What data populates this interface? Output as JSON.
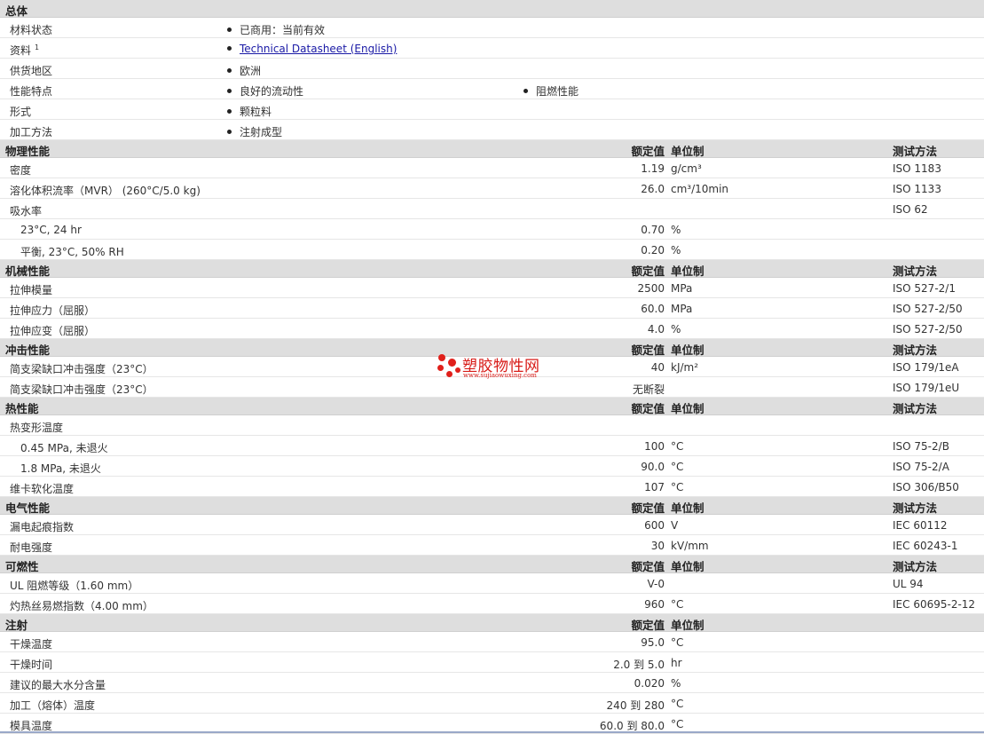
{
  "general": {
    "title": "总体",
    "rows": [
      {
        "label": "材料状态",
        "items": [
          "已商用：当前有效"
        ]
      },
      {
        "label": "资料",
        "sup": "1",
        "items": [
          "Technical Datasheet (English)"
        ],
        "link": true
      },
      {
        "label": "供货地区",
        "items": [
          "欧洲"
        ]
      },
      {
        "label": "性能特点",
        "items": [
          "良好的流动性",
          "阻燃性能"
        ]
      },
      {
        "label": "形式",
        "items": [
          "颗粒料"
        ]
      },
      {
        "label": "加工方法",
        "items": [
          "注射成型"
        ]
      }
    ]
  },
  "headers": {
    "value": "额定值",
    "unit": "单位制",
    "test": "测试方法"
  },
  "sections": [
    {
      "title": "物理性能",
      "show_test": true,
      "rows": [
        {
          "label": "密度",
          "value": "1.19",
          "unit": "g/cm³",
          "test": "ISO 1183"
        },
        {
          "label": "溶化体积流率（MVR） (260°C/5.0 kg)",
          "value": "26.0",
          "unit": "cm³/10min",
          "test": "ISO 1133"
        },
        {
          "label": "吸水率",
          "value": "",
          "unit": "",
          "test": "ISO 62"
        },
        {
          "label": "23°C, 24 hr",
          "value": "0.70",
          "unit": "%",
          "test": "",
          "sub": true
        },
        {
          "label": "平衡, 23°C, 50% RH",
          "value": "0.20",
          "unit": "%",
          "test": "",
          "sub": true
        }
      ]
    },
    {
      "title": "机械性能",
      "show_test": true,
      "rows": [
        {
          "label": "拉伸模量",
          "value": "2500",
          "unit": "MPa",
          "test": "ISO 527-2/1"
        },
        {
          "label": "拉伸应力（屈服）",
          "value": "60.0",
          "unit": "MPa",
          "test": "ISO 527-2/50"
        },
        {
          "label": "拉伸应变（屈服）",
          "value": "4.0",
          "unit": "%",
          "test": "ISO 527-2/50"
        }
      ]
    },
    {
      "title": "冲击性能",
      "show_test": true,
      "rows": [
        {
          "label": "简支梁缺口冲击强度（23°C）",
          "value": "40",
          "unit": "kJ/m²",
          "test": "ISO 179/1eA"
        },
        {
          "label": "简支梁缺口冲击强度（23°C）",
          "value": "无断裂",
          "unit": "",
          "test": "ISO 179/1eU"
        }
      ]
    },
    {
      "title": "热性能",
      "show_test": true,
      "rows": [
        {
          "label": "热变形温度",
          "value": "",
          "unit": "",
          "test": ""
        },
        {
          "label": "0.45 MPa, 未退火",
          "value": "100",
          "unit": "°C",
          "test": "ISO 75-2/B",
          "sub": true
        },
        {
          "label": "1.8 MPa, 未退火",
          "value": "90.0",
          "unit": "°C",
          "test": "ISO 75-2/A",
          "sub": true
        },
        {
          "label": "维卡软化温度",
          "value": "107",
          "unit": "°C",
          "test": "ISO 306/B50"
        }
      ]
    },
    {
      "title": "电气性能",
      "show_test": true,
      "rows": [
        {
          "label": "漏电起痕指数",
          "value": "600",
          "unit": "V",
          "test": "IEC 60112"
        },
        {
          "label": "耐电强度",
          "value": "30",
          "unit": "kV/mm",
          "test": "IEC 60243-1"
        }
      ]
    },
    {
      "title": "可燃性",
      "show_test": true,
      "rows": [
        {
          "label": "UL 阻燃等级（1.60 mm）",
          "value": "V-0",
          "unit": "",
          "test": "UL 94"
        },
        {
          "label": "灼热丝易燃指数（4.00 mm）",
          "value": "960",
          "unit": "°C",
          "test": "IEC 60695-2-12"
        }
      ]
    },
    {
      "title": "注射",
      "show_test": false,
      "rows": [
        {
          "label": "干燥温度",
          "value": "95.0",
          "unit": "°C",
          "test": ""
        },
        {
          "label": "干燥时间",
          "value": "2.0 到  5.0",
          "unit": "hr",
          "test": ""
        },
        {
          "label": "建议的最大水分含量",
          "value": "0.020",
          "unit": "%",
          "test": ""
        },
        {
          "label": "加工（熔体）温度",
          "value": "240 到  280",
          "unit": "°C",
          "test": ""
        },
        {
          "label": "模具温度",
          "value": "60.0 到  80.0",
          "unit": "°C",
          "test": ""
        }
      ]
    }
  ],
  "watermark": {
    "title": "塑胶物性网",
    "url": "www.sujiaowuxing.com"
  },
  "colors": {
    "header_bg": "#dedede",
    "link": "#1a1aa6",
    "watermark": "#d81b17"
  }
}
